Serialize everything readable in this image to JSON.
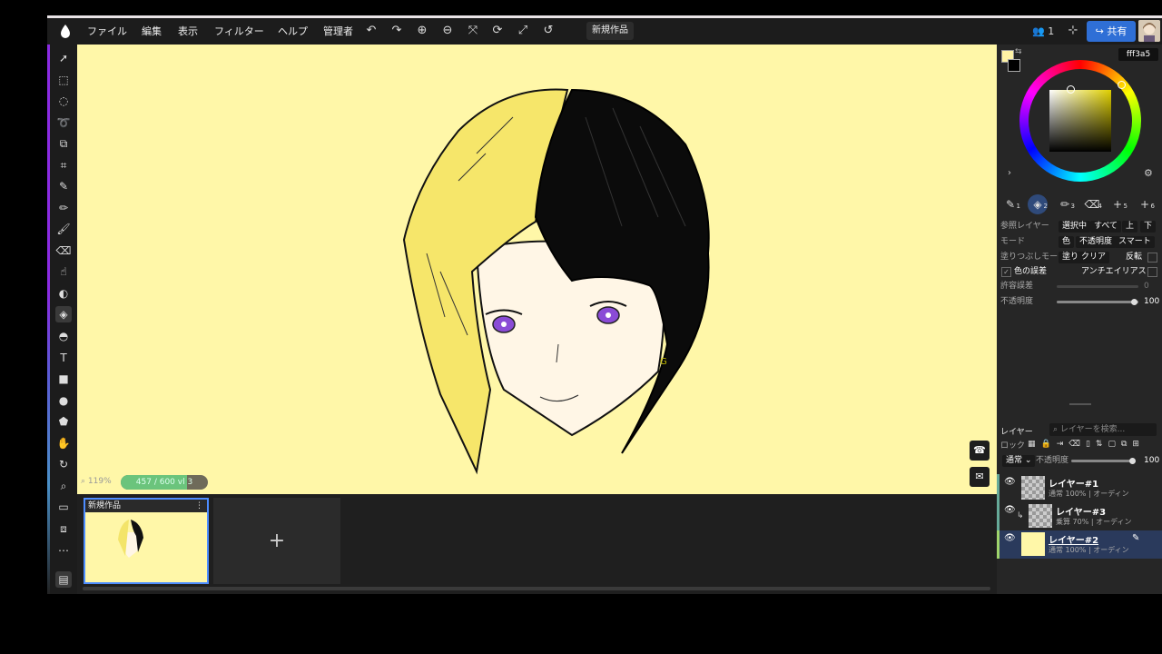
{
  "menu": {
    "items": [
      "ファイル",
      "編集",
      "表示",
      "フィルター",
      "ヘルプ",
      "管理者"
    ],
    "doc_tab": "新規作品",
    "users_count": "1",
    "share_label": "共有"
  },
  "canvas": {
    "zoom": "119%",
    "progress_text": "457 / 600",
    "progress_value": 0.76,
    "progress_extra": "vl 3",
    "background": "#fff7a8"
  },
  "timeline": {
    "frame_title": "新規作品",
    "add_label": "+"
  },
  "color": {
    "hex": "fff3a5",
    "fg": "#fff3a5",
    "bg": "#000000"
  },
  "brushes": [
    "1",
    "2",
    "3",
    "4",
    "5",
    "6"
  ],
  "tool_options": {
    "ref_layer_label": "参照レイヤー",
    "ref_opts": [
      "選択中",
      "すべて",
      "上",
      "下"
    ],
    "mode_label": "モード",
    "mode_opts": [
      "色",
      "不透明度",
      "スマート"
    ],
    "fill_label": "塗りつぶしモー",
    "fill_opts": [
      "塗り",
      "クリア"
    ],
    "invert_label": "反転",
    "color_tol_label": "色の誤差",
    "antialias_label": "アンチエイリアス",
    "tolerance_label": "許容誤差",
    "tolerance_value": "0",
    "opacity_label": "不透明度",
    "opacity_value": "100"
  },
  "layers_panel": {
    "title": "レイヤー",
    "search_placeholder": "レイヤーを検索...",
    "lock_label": "ロック",
    "blend": "通常",
    "opacity_label": "不透明度",
    "opacity_value": "100",
    "layers": [
      {
        "name": "レイヤー#1",
        "sub": "通常 100% | オーディン"
      },
      {
        "name": "レイヤー#3",
        "sub": "乗算 70% | オーディン"
      },
      {
        "name": "レイヤー#2",
        "sub": "通常 100% | オーディン"
      }
    ]
  }
}
